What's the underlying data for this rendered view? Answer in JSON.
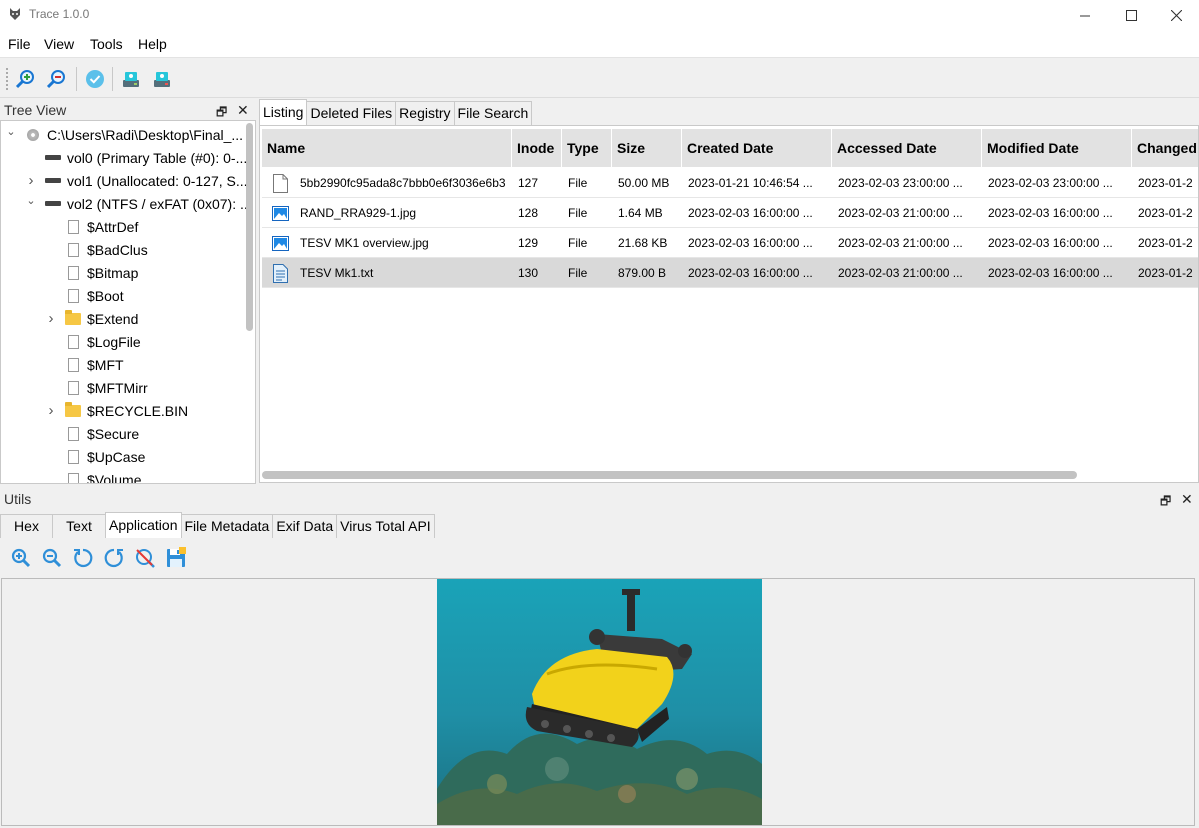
{
  "window": {
    "title": "Trace 1.0.0"
  },
  "menu": [
    "File",
    "View",
    "Tools",
    "Help"
  ],
  "toolbar": {
    "buttons": [
      "add-image-icon",
      "remove-image-icon",
      "verify-icon",
      "mount-drive-icon",
      "unmount-drive-icon"
    ]
  },
  "tree_view": {
    "title": "Tree View",
    "items": [
      {
        "label": "C:\\Users\\Radi\\Desktop\\Final_...",
        "icon": "disc-icon",
        "arrow": "expanded",
        "level": 0
      },
      {
        "label": "vol0 (Primary Table (#0): 0-...",
        "icon": "drive-icon",
        "arrow": "none",
        "level": 1
      },
      {
        "label": "vol1 (Unallocated: 0-127, S...",
        "icon": "drive-icon",
        "arrow": "collapsed",
        "level": 1
      },
      {
        "label": "vol2 (NTFS / exFAT (0x07): ...",
        "icon": "drive-icon",
        "arrow": "expanded",
        "level": 1
      },
      {
        "label": "$AttrDef",
        "icon": "file-icon",
        "arrow": "none",
        "level": 2
      },
      {
        "label": "$BadClus",
        "icon": "file-icon",
        "arrow": "none",
        "level": 2
      },
      {
        "label": "$Bitmap",
        "icon": "file-icon",
        "arrow": "none",
        "level": 2
      },
      {
        "label": "$Boot",
        "icon": "file-icon",
        "arrow": "none",
        "level": 2
      },
      {
        "label": "$Extend",
        "icon": "folder-icon",
        "arrow": "collapsed",
        "level": 2
      },
      {
        "label": "$LogFile",
        "icon": "file-icon",
        "arrow": "none",
        "level": 2
      },
      {
        "label": "$MFT",
        "icon": "file-icon",
        "arrow": "none",
        "level": 2
      },
      {
        "label": "$MFTMirr",
        "icon": "file-icon",
        "arrow": "none",
        "level": 2
      },
      {
        "label": "$RECYCLE.BIN",
        "icon": "folder-icon",
        "arrow": "collapsed",
        "level": 2
      },
      {
        "label": "$Secure",
        "icon": "file-icon",
        "arrow": "none",
        "level": 2
      },
      {
        "label": "$UpCase",
        "icon": "file-icon",
        "arrow": "none",
        "level": 2
      },
      {
        "label": "$Volume",
        "icon": "file-icon",
        "arrow": "none",
        "level": 2
      }
    ]
  },
  "main_tabs": {
    "items": [
      "Listing",
      "Deleted Files",
      "Registry",
      "File Search"
    ],
    "active": "Listing"
  },
  "listing": {
    "columns": [
      "Name",
      "Inode",
      "Type",
      "Size",
      "Created Date",
      "Accessed Date",
      "Modified Date",
      "Changed"
    ],
    "rows": [
      {
        "icon": "file-icon",
        "name": "5bb2990fc95ada8c7bbb0e6f3036e6b3",
        "inode": "127",
        "type": "File",
        "size": "50.00 MB",
        "created": "2023-01-21 10:46:54 ...",
        "accessed": "2023-02-03 23:00:00 ...",
        "modified": "2023-02-03 23:00:00 ...",
        "changed": "2023-01-2",
        "selected": false
      },
      {
        "icon": "image-file-icon",
        "name": "RAND_RRA929-1.jpg",
        "inode": "128",
        "type": "File",
        "size": "1.64 MB",
        "created": "2023-02-03 16:00:00 ...",
        "accessed": "2023-02-03 21:00:00 ...",
        "modified": "2023-02-03 16:00:00 ...",
        "changed": "2023-01-2",
        "selected": false
      },
      {
        "icon": "image-file-icon",
        "name": "TESV MK1 overview.jpg",
        "inode": "129",
        "type": "File",
        "size": "21.68 KB",
        "created": "2023-02-03 16:00:00 ...",
        "accessed": "2023-02-03 21:00:00 ...",
        "modified": "2023-02-03 16:00:00 ...",
        "changed": "2023-01-2",
        "selected": false
      },
      {
        "icon": "text-file-icon",
        "name": "TESV Mk1.txt",
        "inode": "130",
        "type": "File",
        "size": "879.00 B",
        "created": "2023-02-03 16:00:00 ...",
        "accessed": "2023-02-03 21:00:00 ...",
        "modified": "2023-02-03 16:00:00 ...",
        "changed": "2023-01-2",
        "selected": true
      }
    ]
  },
  "utils": {
    "title": "Utils",
    "tabs": [
      "Hex",
      "Text",
      "Application",
      "File Metadata",
      "Exif Data",
      "Virus Total API"
    ],
    "active": "Application",
    "toolbar": [
      "zoom-in-icon",
      "zoom-out-icon",
      "rotate-left-icon",
      "rotate-right-icon",
      "reset-view-icon",
      "save-icon"
    ]
  },
  "colors": {
    "accent": "#2f8fd8",
    "selected_row": "#d9d9d9",
    "header_bg": "#e2e2e2"
  }
}
